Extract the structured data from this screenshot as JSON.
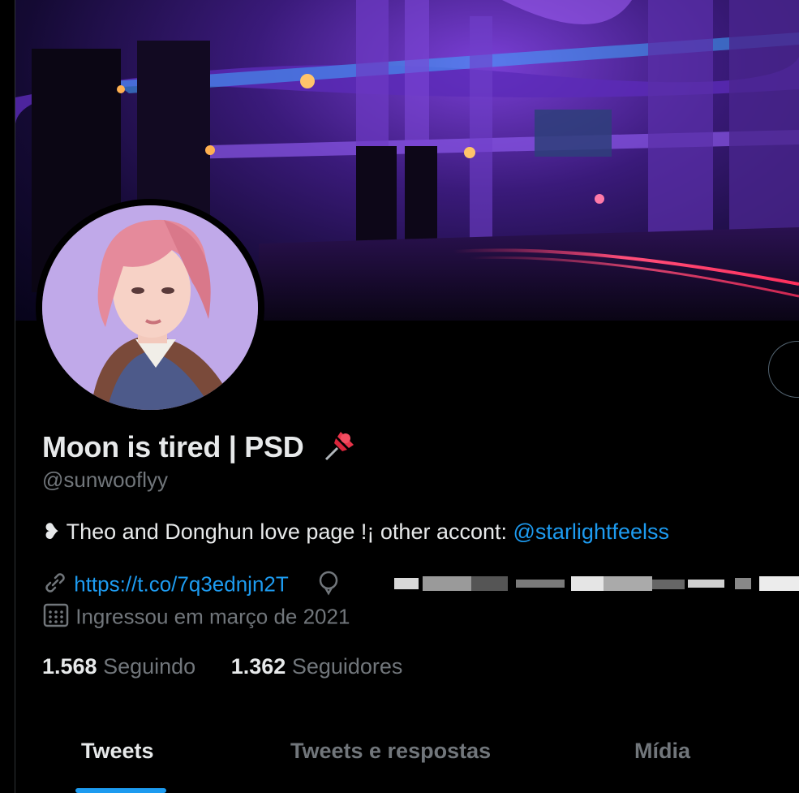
{
  "profile": {
    "display_name": "Moon is tired | PSD",
    "name_emoji": "pushpin-icon",
    "handle": "@sunwooflyy",
    "bio_prefix": "❥ Theo and Donghun love page !¡ other accont: ",
    "bio_mention": "@starlightfeelss",
    "website": "https://t.co/7q3ednjn2T",
    "location_redacted": true,
    "joined": "Ingressou em março de 2021"
  },
  "stats": {
    "following_count": "1.568",
    "following_label": "Seguindo",
    "followers_count": "1.362",
    "followers_label": "Seguidores"
  },
  "tabs": [
    {
      "label": "Tweets",
      "active": true
    },
    {
      "label": "Tweets e respostas",
      "active": false
    },
    {
      "label": "Mídia",
      "active": false
    }
  ],
  "colors": {
    "background": "#000000",
    "text": "#e7e9ea",
    "secondary": "#71767b",
    "accent": "#1d9bf0"
  }
}
